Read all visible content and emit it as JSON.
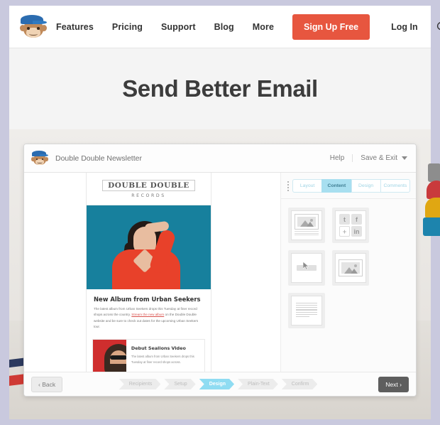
{
  "site": {
    "logo_icon": "mailchimp-freddie-logo",
    "nav": [
      {
        "label": "Features"
      },
      {
        "label": "Pricing"
      },
      {
        "label": "Support"
      },
      {
        "label": "Blog"
      },
      {
        "label": "More"
      }
    ],
    "signup_label": "Sign Up Free",
    "login_label": "Log In",
    "search_icon": "search-icon",
    "hero_title": "Send Better Email",
    "accent_color": "#e7563f",
    "hero_bg": "#f4f4f4"
  },
  "editor": {
    "logo_icon": "mailchimp-freddie-logo",
    "campaign_title": "Double Double Newsletter",
    "help_label": "Help",
    "save_label": "Save & Exit",
    "caret_icon": "chevron-down-icon",
    "grip_icon": "drag-handle-icon",
    "tabs": [
      {
        "label": "Layout",
        "active": false
      },
      {
        "label": "Content",
        "active": true
      },
      {
        "label": "Design",
        "active": false
      },
      {
        "label": "Comments",
        "active": false
      }
    ],
    "blocks": [
      {
        "name": "image-card-block",
        "type": "image-caption"
      },
      {
        "name": "social-follow-block",
        "type": "social"
      },
      {
        "name": "button-block",
        "type": "button"
      },
      {
        "name": "image-block",
        "type": "image"
      },
      {
        "name": "text-block",
        "type": "text"
      }
    ],
    "social_icons": [
      "twitter-icon",
      "facebook-icon",
      "plus-icon",
      "linkedin-icon"
    ],
    "drag_cursor_icon": "cursor-arrow-icon",
    "back_label": "Back",
    "back_icon": "chevron-left-icon",
    "next_label": "Next",
    "next_icon": "chevron-right-icon",
    "steps": [
      {
        "label": "Recipients",
        "active": false
      },
      {
        "label": "Setup",
        "active": false
      },
      {
        "label": "Design",
        "active": true
      },
      {
        "label": "Plain-Text",
        "active": false
      },
      {
        "label": "Confirm",
        "active": false
      }
    ],
    "active_tab_color": "#a8dff0",
    "active_step_color": "#8fdcf2"
  },
  "email": {
    "brand_name": "DOUBLE DOUBLE",
    "brand_sub": "RECORDS",
    "hero_photo_alt": "woman-in-red-sweater-shading-eyes",
    "article_heading": "New Album from Urban Seekers",
    "article_body_1": "The latest album from Urban Seekers drops this Tuesday at finer record shops across the country. ",
    "article_link": "Stream the new album",
    "article_body_2": " on the Double Double website and be sure to check out dates for the upcoming Urban Seekers tour.",
    "card_heading": "Debut Sealions Video",
    "card_body": "The latest album from Urban Seekers drops this Tuesday at finer record shops across.",
    "card_photo_alt": "man-with-sunglasses-on-red-background"
  }
}
